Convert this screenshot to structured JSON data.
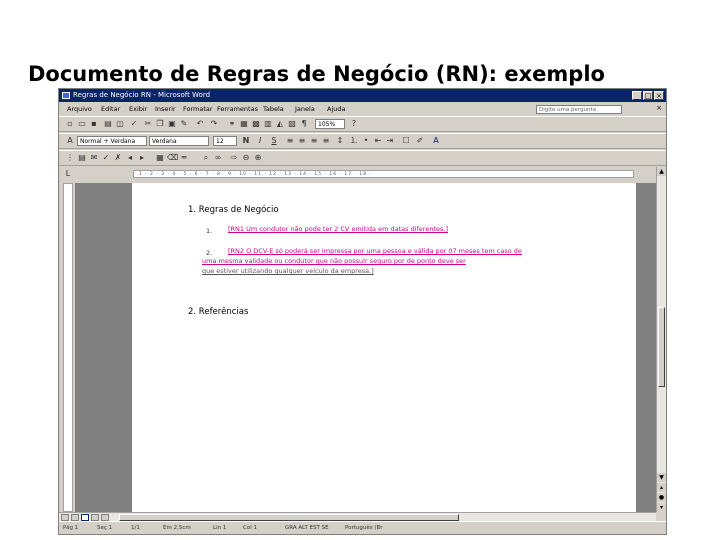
{
  "slide": {
    "title": "Documento de Regras de Negócio (RN): exemplo"
  },
  "window": {
    "title": "Regras de Negócio RN - Microsoft Word",
    "minimize": "_",
    "maximize": "□",
    "close": "×"
  },
  "menu": {
    "items": [
      "Arquivo",
      "Editar",
      "Exibir",
      "Inserir",
      "Formatar",
      "Ferramentas",
      "Tabela",
      "Janela",
      "Ajuda"
    ],
    "help_placeholder": "Digite uma pergunta",
    "close_doc": "×"
  },
  "toolbar": {
    "zoom": "105%",
    "style": "Normal + Verdana",
    "font": "Verdana",
    "size": "12",
    "bold": "N",
    "italic": "I",
    "underline": "S"
  },
  "ruler": {
    "marks": "· 1 · 2 · 3 · 4 · 5 · 6 · 7 · 8 · 9 · 10 · 11 · 12 · 13 · 14 · 15 · 16 · 17 · 18 ·"
  },
  "document": {
    "section1": "1. Regras de Negócio",
    "rule1": {
      "num": "1.",
      "text": "[RN1 Um condutor não pode ter 2 CV emitida em datas diferentes.]"
    },
    "rule2": {
      "num": "2.",
      "line1": "[RN2 O DCV-E só poderá ser impressa por uma pessoa e válida por 07 meses tem caso de",
      "line2": "uma mesma validade ou condutor que não possuir seguro por de ponto deve ser",
      "line3": "que estiver utilizando qualquer veículo da empresa.]"
    },
    "section2": "2. Referências"
  },
  "status": {
    "page": "Pág 1",
    "section": "Seç 1",
    "pages": "1/1",
    "position": "Em 2,5cm",
    "line": "Lin 1",
    "col": "Col 1",
    "modes": "GRA  ALT  EST  SE",
    "language": "Português (Br"
  }
}
